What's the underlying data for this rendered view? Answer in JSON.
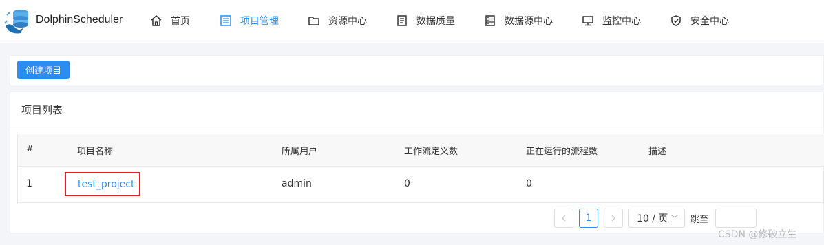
{
  "app": {
    "brand": "DolphinScheduler"
  },
  "nav": [
    {
      "label": "首页",
      "icon": "home-icon"
    },
    {
      "label": "项目管理",
      "icon": "list-icon",
      "active": true
    },
    {
      "label": "资源中心",
      "icon": "folder-icon"
    },
    {
      "label": "数据质量",
      "icon": "document-icon"
    },
    {
      "label": "数据源中心",
      "icon": "database-icon"
    },
    {
      "label": "监控中心",
      "icon": "monitor-icon"
    },
    {
      "label": "安全中心",
      "icon": "shield-icon"
    }
  ],
  "actions": {
    "create_label": "创建项目"
  },
  "panel": {
    "title": "项目列表"
  },
  "table": {
    "headers": [
      "#",
      "项目名称",
      "所属用户",
      "工作流定义数",
      "正在运行的流程数",
      "描述"
    ],
    "rows": [
      {
        "index": "1",
        "name": "test_project",
        "user": "admin",
        "definitions": "0",
        "running": "0",
        "description": ""
      }
    ]
  },
  "pagination": {
    "current": "1",
    "page_size": "10 / 页",
    "jump_label": "跳至",
    "jump_value": ""
  },
  "watermark": "CSDN @修破立生",
  "colors": {
    "accent": "#2d8cf0",
    "highlight_box": "#d9262b"
  }
}
